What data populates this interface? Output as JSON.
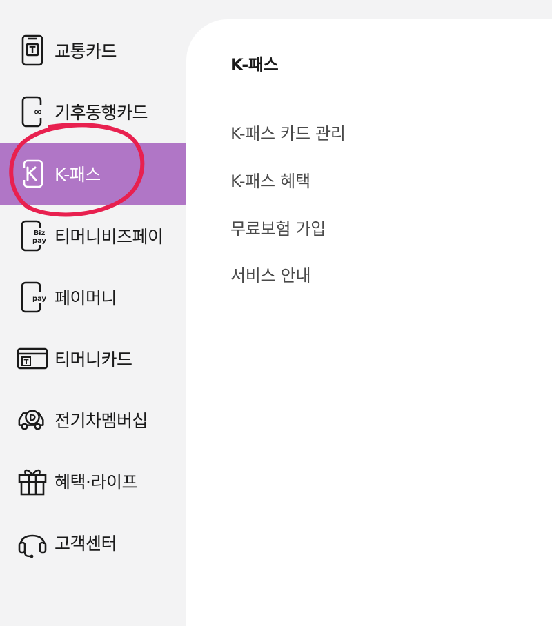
{
  "sidebar": {
    "items": [
      {
        "label": "교통카드",
        "icon": "transit-card-icon"
      },
      {
        "label": "기후동행카드",
        "icon": "climate-card-icon"
      },
      {
        "label": "K-패스",
        "icon": "k-pass-icon",
        "active": true
      },
      {
        "label": "티머니비즈페이",
        "icon": "biz-pay-icon"
      },
      {
        "label": "페이머니",
        "icon": "pay-money-icon"
      },
      {
        "label": "티머니카드",
        "icon": "tmoney-card-icon"
      },
      {
        "label": "전기차멤버십",
        "icon": "ev-membership-icon"
      },
      {
        "label": "혜택·라이프",
        "icon": "gift-icon"
      },
      {
        "label": "고객센터",
        "icon": "headset-icon"
      }
    ],
    "active_color": "#b076c6"
  },
  "panel": {
    "title": "K-패스",
    "items": [
      "K-패스 카드 관리",
      "K-패스 혜택",
      "무료보험 가입",
      "서비스 안내"
    ]
  },
  "annotation": {
    "color": "#e8204f"
  }
}
